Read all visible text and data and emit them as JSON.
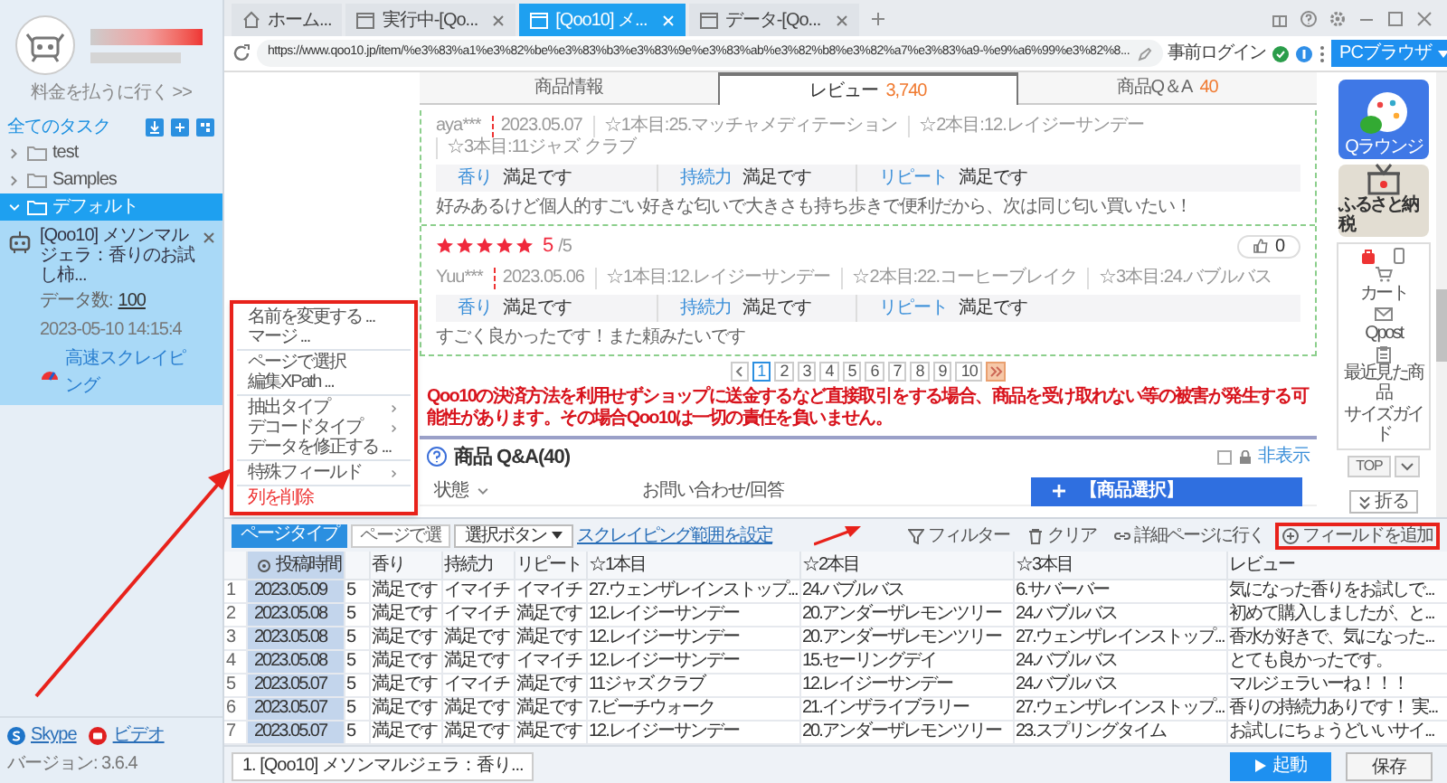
{
  "sidebar": {
    "account_link": "料金を払うに行く >>",
    "all_tasks": "全てのタスク",
    "folders": [
      {
        "label": "test",
        "expanded": false,
        "selected": false
      },
      {
        "label": "Samples",
        "expanded": false,
        "selected": false
      },
      {
        "label": "デフォルト",
        "expanded": true,
        "selected": true,
        "children": [
          {
            "title": "[Qoo10] メソンマルジェラ：香りのお試し柿...",
            "count_label": "データ数:",
            "count": "100",
            "time": "2023-05-10 14:15:4",
            "mode": "高速スクレイピング"
          }
        ]
      }
    ],
    "footer": {
      "links": [
        "Skype",
        "ビデオ"
      ],
      "version": "バージョン: 3.6.4"
    }
  },
  "browser_tabs": [
    {
      "label": "ホーム...",
      "kind": "home",
      "selected": false
    },
    {
      "label": "実行中-[Qo...",
      "kind": "page",
      "selected": false
    },
    {
      "label": "[Qoo10] メ...",
      "kind": "page",
      "selected": true
    },
    {
      "label": "データ-[Qo...",
      "kind": "page",
      "selected": false
    }
  ],
  "address_bar": {
    "url": "https://www.qoo10.jp/item/%e3%83%a1%e3%82%be%e3%83%b3%e3%83%9e%e3%83%ab%e3%82%b8%e3%82%a7%e3%83%a9-%e9%a6%99%e3%82%8...",
    "login": "事前ログイン",
    "browser_button": "PCブラウザ"
  },
  "page": {
    "product_tabs": [
      {
        "label": "商品情報",
        "selected": false
      },
      {
        "label": "レビュー",
        "count": "3,740",
        "selected": true
      },
      {
        "label": "商品Q＆A",
        "count": "40",
        "selected": false
      }
    ],
    "reviews": [
      {
        "user": "aya***",
        "date": "2023.05.07",
        "picks": [
          "☆1本目:25.マッチャメディテーション",
          "☆2本目:12.レイジーサンデー",
          "☆3本目:11ジャズ クラブ"
        ],
        "attributes": [
          {
            "name": "香り",
            "value": "満足です"
          },
          {
            "name": "持続力",
            "value": "満足です"
          },
          {
            "name": "リピート",
            "value": "満足です"
          }
        ],
        "text": "好みあるけど個人的すごい好きな匂いで大きさも持ち歩きで便利だから、次は同じ匂い買いたい！"
      },
      {
        "stars": 5,
        "score": "5",
        "score_max": "/5",
        "likes": "0",
        "user": "Yuu***",
        "date": "2023.05.06",
        "picks": [
          "☆1本目:12.レイジーサンデー",
          "☆2本目:22.コーヒーブレイク",
          "☆3本目:24.バブルバス"
        ],
        "attributes": [
          {
            "name": "香り",
            "value": "満足です"
          },
          {
            "name": "持続力",
            "value": "満足です"
          },
          {
            "name": "リピート",
            "value": "満足です"
          }
        ],
        "text": "すごく良かったです！また頼みたいです"
      }
    ],
    "pagination": [
      {
        "label": "1",
        "selected": true
      },
      {
        "label": "2",
        "selected": false
      },
      {
        "label": "3",
        "selected": false
      },
      {
        "label": "4",
        "selected": false
      },
      {
        "label": "5",
        "selected": false
      },
      {
        "label": "6",
        "selected": false
      },
      {
        "label": "7",
        "selected": false
      },
      {
        "label": "8",
        "selected": false
      },
      {
        "label": "9",
        "selected": false
      },
      {
        "label": "10",
        "selected": false
      }
    ],
    "warning": "Qoo10の決済方法を利用せずショップに送金するなど直接取引をする場合、商品を受け取れない等の被害が発生する可能性があります。その場合Qoo10は一切の責任を負いません。",
    "qa": {
      "title": "商品 Q&A(40)",
      "hide_label": "非表示",
      "status_label": "状態",
      "column_label": "お問い合わせ/回答"
    },
    "product_select": "【商品選択】",
    "side_panel": {
      "tiles": [
        "Qラウンジ",
        "ふるさと納税"
      ],
      "links": [
        "カート",
        "Qpost",
        "最近見た商品",
        "サイズガイド"
      ],
      "top": "TOP"
    },
    "collapse": "折る"
  },
  "context_menu": {
    "highlighted": true,
    "groups": [
      [
        {
          "label": "名前を変更する ...",
          "kind": "action"
        },
        {
          "label": "マージ ...",
          "kind": "action"
        }
      ],
      [
        {
          "label": "ページで選択",
          "kind": "action"
        },
        {
          "label": "編集XPath ...",
          "kind": "action"
        }
      ],
      [
        {
          "label": "抽出タイプ",
          "kind": "submenu"
        },
        {
          "label": "デコードタイプ",
          "kind": "submenu"
        },
        {
          "label": "データを修正する ...",
          "kind": "action"
        }
      ],
      [
        {
          "label": "特殊フィールド",
          "kind": "submenu"
        }
      ],
      [
        {
          "label": "列を削除",
          "kind": "danger"
        }
      ]
    ]
  },
  "extractor": {
    "page_type": "ページタイプ",
    "page_select": "ページで選",
    "select_button": "選択ボタン",
    "range_link": "スクレイピング範囲を設定",
    "actions": [
      {
        "label": "フィルター",
        "kind": "filter",
        "highlighted": false
      },
      {
        "label": "クリア",
        "kind": "clear",
        "highlighted": false
      },
      {
        "label": "詳細ページに行く",
        "kind": "link",
        "highlighted": false
      },
      {
        "label": "フィールドを追加",
        "kind": "add",
        "highlighted": true
      }
    ],
    "columns": [
      {
        "label": "投稿時間",
        "selected": true
      },
      {
        "selected": false
      },
      {
        "label": "香り",
        "selected": false
      },
      {
        "label": "持続力",
        "selected": false
      },
      {
        "label": "リピート",
        "selected": false
      },
      {
        "label": "☆1本目",
        "selected": false
      },
      {
        "label": "☆2本目",
        "selected": false
      },
      {
        "label": "☆3本目",
        "selected": false
      },
      {
        "label": "レビュー",
        "selected": false
      }
    ],
    "rows": [
      {
        "index": "1",
        "cells": [
          "2023.05.09",
          "5",
          "満足です",
          "イマイチ",
          "イマイチ",
          "27.ウェンザレインストップ...",
          "24.バブルバス",
          "6.サバーバー",
          "気になった香りをお試しで..."
        ]
      },
      {
        "index": "2",
        "cells": [
          "2023.05.08",
          "5",
          "満足です",
          "イマイチ",
          "満足です",
          "12.レイジーサンデー",
          "20.アンダーザレモンツリー",
          "24.バブルバス",
          "初めて購入しましたが、と..."
        ]
      },
      {
        "index": "3",
        "cells": [
          "2023.05.08",
          "5",
          "満足です",
          "満足です",
          "満足です",
          "12.レイジーサンデー",
          "20.アンダーザレモンツリー",
          "27.ウェンザレインストップ...",
          "香水が好きで、気になった..."
        ]
      },
      {
        "index": "4",
        "cells": [
          "2023.05.08",
          "5",
          "満足です",
          "満足です",
          "イマイチ",
          "12.レイジーサンデー",
          "15.セーリングデイ",
          "24.バブルバス",
          "とても良かったです。"
        ]
      },
      {
        "index": "5",
        "cells": [
          "2023.05.07",
          "5",
          "満足です",
          "イマイチ",
          "満足です",
          "11ジャズ クラブ",
          "12.レイジーサンデー",
          "24.バブルバス",
          "マルジェラいーね！！！"
        ]
      },
      {
        "index": "6",
        "cells": [
          "2023.05.07",
          "5",
          "満足です",
          "満足です",
          "満足です",
          "7.ビーチウォーク",
          "21.インザライブラリー",
          "27.ウェンザレインストップ...",
          "香りの持続力ありです！ 実..."
        ]
      },
      {
        "index": "7",
        "cells": [
          "2023.05.07",
          "5",
          "満足です",
          "満足です",
          "満足です",
          "12.レイジーサンデー",
          "20.アンダーザレモンツリー",
          "23.スプリングタイム",
          "お試しにちょうどいいサイ..."
        ]
      }
    ]
  },
  "bottom_bar": {
    "task_tab": "1. [Qoo10] メソンマルジェラ：香り...",
    "start": "起動",
    "save": "保存"
  }
}
